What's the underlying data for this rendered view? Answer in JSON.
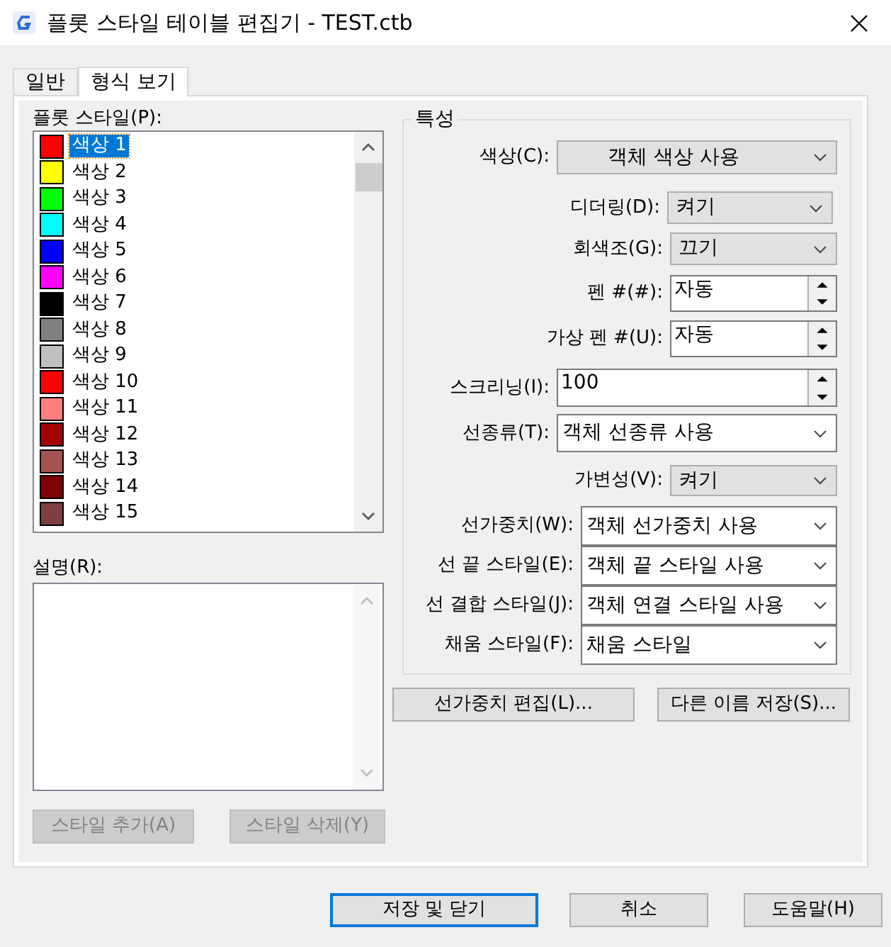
{
  "window": {
    "title": "플롯 스타일 테이블 편집기 - TEST.ctb"
  },
  "tabs": [
    {
      "label": "일반",
      "selected": false
    },
    {
      "label": "형식 보기",
      "selected": true
    }
  ],
  "plot_styles": {
    "label": "플롯 스타일(P):",
    "items": [
      {
        "name": "색상 1",
        "color": "#ff0000",
        "selected": true
      },
      {
        "name": "색상 2",
        "color": "#ffff00",
        "selected": false
      },
      {
        "name": "색상 3",
        "color": "#00ff00",
        "selected": false
      },
      {
        "name": "색상 4",
        "color": "#00ffff",
        "selected": false
      },
      {
        "name": "색상 5",
        "color": "#0000ff",
        "selected": false
      },
      {
        "name": "색상 6",
        "color": "#ff00ff",
        "selected": false
      },
      {
        "name": "색상 7",
        "color": "#000000",
        "selected": false
      },
      {
        "name": "색상 8",
        "color": "#808080",
        "selected": false
      },
      {
        "name": "색상 9",
        "color": "#c0c0c0",
        "selected": false
      },
      {
        "name": "색상 10",
        "color": "#ff0000",
        "selected": false
      },
      {
        "name": "색상 11",
        "color": "#ff7f7f",
        "selected": false
      },
      {
        "name": "색상 12",
        "color": "#a50000",
        "selected": false
      },
      {
        "name": "색상 13",
        "color": "#a55252",
        "selected": false
      },
      {
        "name": "색상 14",
        "color": "#7f0000",
        "selected": false
      },
      {
        "name": "색상 15",
        "color": "#7f3f3f",
        "selected": false
      }
    ]
  },
  "description": {
    "label": "설명(R):"
  },
  "style_buttons": [
    {
      "label": "스타일 추가(A)",
      "disabled": true
    },
    {
      "label": "스타일 삭제(Y)",
      "disabled": true
    }
  ],
  "properties": {
    "title": "특성",
    "rows": [
      {
        "label": "색상(C):",
        "kind": "select",
        "value": "객체 색상 사용"
      },
      {
        "label": "디더링(D):",
        "kind": "select",
        "value": "켜기"
      },
      {
        "label": "회색조(G):",
        "kind": "select",
        "value": "끄기"
      },
      {
        "label": "펜 #(#):",
        "kind": "spinner",
        "value": "자동"
      },
      {
        "label": "가상 펜 #(U):",
        "kind": "spinner",
        "value": "자동"
      },
      {
        "label": "스크리닝(I):",
        "kind": "spinner",
        "value": "100"
      },
      {
        "label": "선종류(T):",
        "kind": "combo",
        "value": "객체 선종류 사용"
      },
      {
        "label": "가변성(V):",
        "kind": "select",
        "value": "켜기"
      },
      {
        "label": "선가중치(W):",
        "kind": "combo",
        "value": "객체 선가중치 사용"
      },
      {
        "label": "선 끝 스타일(E):",
        "kind": "combo",
        "value": "객체 끝 스타일 사용"
      },
      {
        "label": "선 결합 스타일(J):",
        "kind": "combo",
        "value": "객체 연결 스타일 사용"
      },
      {
        "label": "채움 스타일(F):",
        "kind": "combo",
        "value": "채움 스타일"
      }
    ]
  },
  "property_buttons": [
    {
      "label": "선가중치 편집(L)..."
    },
    {
      "label": "다른 이름 저장(S)..."
    }
  ],
  "dialog_buttons": [
    {
      "label": "저장 및 닫기",
      "default": true
    },
    {
      "label": "취소",
      "default": false
    },
    {
      "label": "도움말(H)",
      "default": false
    }
  ]
}
